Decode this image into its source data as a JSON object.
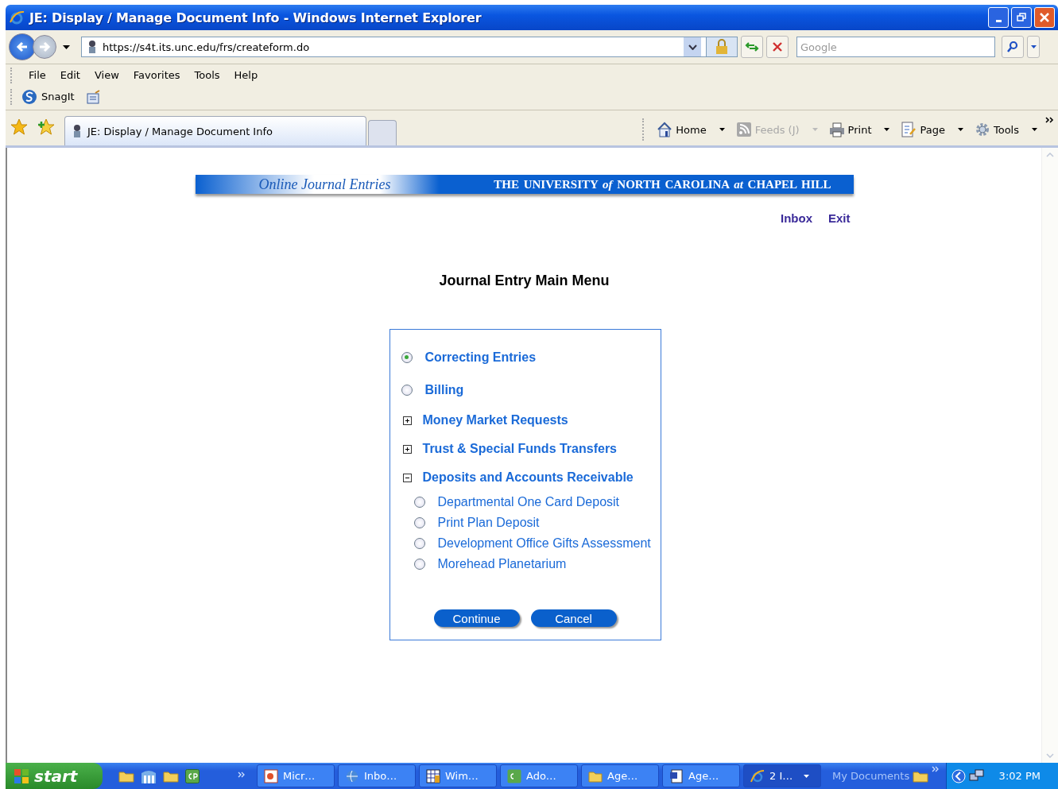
{
  "window": {
    "title": "JE: Display / Manage Document Info - Windows Internet Explorer"
  },
  "address_bar": {
    "url": "https://s4t.its.unc.edu/frs/createform.do"
  },
  "search": {
    "placeholder": "Google"
  },
  "menu_bar": [
    "File",
    "Edit",
    "View",
    "Favorites",
    "Tools",
    "Help"
  ],
  "links_toolbar": {
    "label": "SnagIt"
  },
  "tab": {
    "title": "JE: Display / Manage Document Info"
  },
  "command_bar": [
    {
      "label": "Home",
      "disabled": false
    },
    {
      "label": "Feeds (J)",
      "disabled": true
    },
    {
      "label": "Print",
      "disabled": false
    },
    {
      "label": "Page",
      "disabled": false
    },
    {
      "label": "Tools",
      "disabled": false
    }
  ],
  "page": {
    "banner_left": "Online Journal Entries",
    "banner_right": "THE UNIVERSITY *of* NORTH CAROLINA *at* CHAPEL HILL",
    "links": [
      "Inbox",
      "Exit"
    ],
    "heading": "Journal Entry Main Menu",
    "options": [
      {
        "kind": "radio",
        "label": "Correcting Entries",
        "selected": true
      },
      {
        "kind": "radio",
        "label": "Billing",
        "selected": false
      },
      {
        "kind": "group",
        "label": "Money Market Requests",
        "expanded": false
      },
      {
        "kind": "group",
        "label": "Trust & Special Funds Transfers",
        "expanded": false
      },
      {
        "kind": "group",
        "label": "Deposits and Accounts Receivable",
        "expanded": true,
        "children": [
          {
            "label": "Departmental One Card Deposit",
            "selected": false
          },
          {
            "label": "Print Plan Deposit",
            "selected": false
          },
          {
            "label": "Development Office Gifts Assessment",
            "selected": false
          },
          {
            "label": "Morehead Planetarium",
            "selected": false
          }
        ]
      }
    ],
    "buttons": [
      "Continue",
      "Cancel"
    ]
  },
  "taskbar": {
    "start": "start",
    "tasks": [
      {
        "label": "Micr…",
        "selected": false
      },
      {
        "label": "Inbo…",
        "selected": false
      },
      {
        "label": "Wim…",
        "selected": false
      },
      {
        "label": "Ado…",
        "selected": false
      },
      {
        "label": "Age…",
        "selected": false
      },
      {
        "label": "Age…",
        "selected": false
      },
      {
        "label": "2 I…",
        "selected": true
      }
    ],
    "toolbar_label": "My Documents",
    "clock": "3:02 PM"
  }
}
